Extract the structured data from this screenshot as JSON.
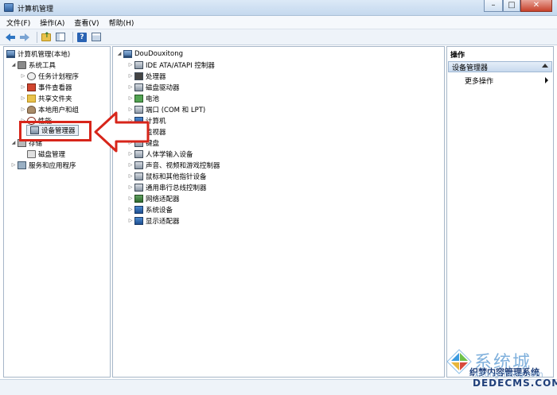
{
  "window": {
    "title": "计算机管理",
    "minimize": "–",
    "maximize": "□",
    "close": "✕"
  },
  "menu": [
    "文件(F)",
    "操作(A)",
    "查看(V)",
    "帮助(H)"
  ],
  "toolbar": [
    "back-icon",
    "forward-icon",
    "up-folder-icon",
    "show-hide-tree-icon",
    "help-icon",
    "view-icon"
  ],
  "left_tree": [
    {
      "label": "计算机管理(本地)",
      "icon": "computer"
    },
    {
      "label": "系统工具",
      "icon": "tools"
    },
    {
      "label": "任务计划程序",
      "icon": "clock"
    },
    {
      "label": "事件查看器",
      "icon": "event"
    },
    {
      "label": "共享文件夹",
      "icon": "share"
    },
    {
      "label": "本地用户和组",
      "icon": "users"
    },
    {
      "label": "性能",
      "icon": "perf"
    },
    {
      "label": "设备管理器",
      "icon": "devmgr"
    },
    {
      "label": "存储",
      "icon": "storage"
    },
    {
      "label": "磁盘管理",
      "icon": "disk"
    },
    {
      "label": "服务和应用程序",
      "icon": "services"
    }
  ],
  "device_tree": {
    "root": "DouDouxitong",
    "items": [
      "IDE ATA/ATAPI 控制器",
      "处理器",
      "磁盘驱动器",
      "电池",
      "端口 (COM 和 LPT)",
      "计算机",
      "监视器",
      "键盘",
      "人体学输入设备",
      "声音、视频和游戏控制器",
      "鼠标和其他指针设备",
      "通用串行总线控制器",
      "网络适配器",
      "系统设备",
      "显示适配器"
    ]
  },
  "actions": {
    "title": "操作",
    "section": "设备管理器",
    "more": "更多操作"
  },
  "watermark": {
    "brand": "系统城",
    "site_cn": "织梦内容管理系统",
    "url": "DEDECMS.COM",
    "sub": "xitongcheng.com"
  },
  "colors": {
    "highlight": "#d7251a"
  }
}
